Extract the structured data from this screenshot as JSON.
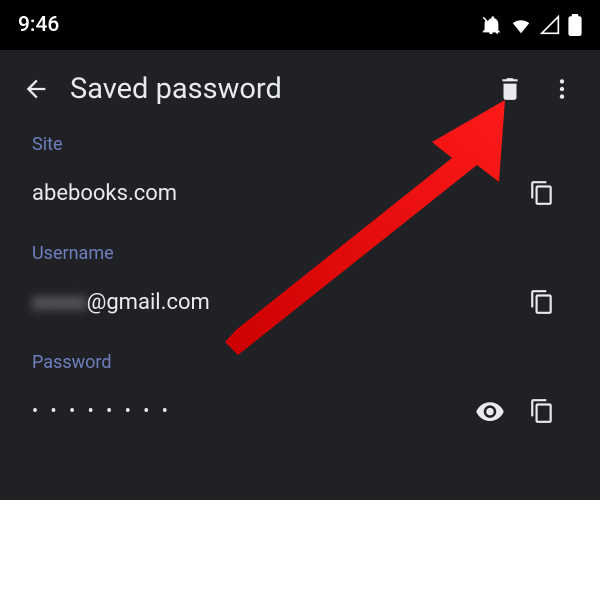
{
  "status": {
    "time": "9:46"
  },
  "appbar": {
    "title": "Saved password"
  },
  "fields": {
    "site": {
      "label": "Site",
      "value": "abebooks.com"
    },
    "username": {
      "label": "Username",
      "value_hidden": "xxxxx",
      "value_suffix": "@gmail.com"
    },
    "password": {
      "label": "Password",
      "value_masked": "• • • • • • • •"
    }
  }
}
